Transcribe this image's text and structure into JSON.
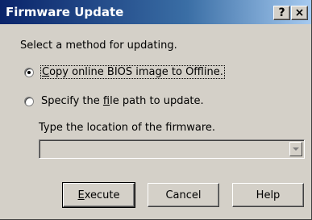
{
  "window": {
    "title": "Firmware Update",
    "help_glyph": "?",
    "close_glyph": "×"
  },
  "prompt": "Select a method for updating.",
  "options": [
    {
      "pre": "",
      "accel": "C",
      "post": "opy online BIOS image to Offline.",
      "selected": true
    },
    {
      "pre": "Specify the ",
      "accel": "f",
      "post": "ile path to update.",
      "selected": false
    }
  ],
  "location": {
    "label": "Type the location of the firmware.",
    "value": "",
    "enabled": false
  },
  "buttons": {
    "execute_accel": "E",
    "execute_rest": "xecute",
    "cancel": "Cancel",
    "help": "Help"
  },
  "icons": {
    "dropdown_arrow": "triangle-down-icon"
  },
  "colors": {
    "title_start": "#0a246a",
    "title_end": "#a6caf0",
    "face": "#d4d0c8"
  }
}
